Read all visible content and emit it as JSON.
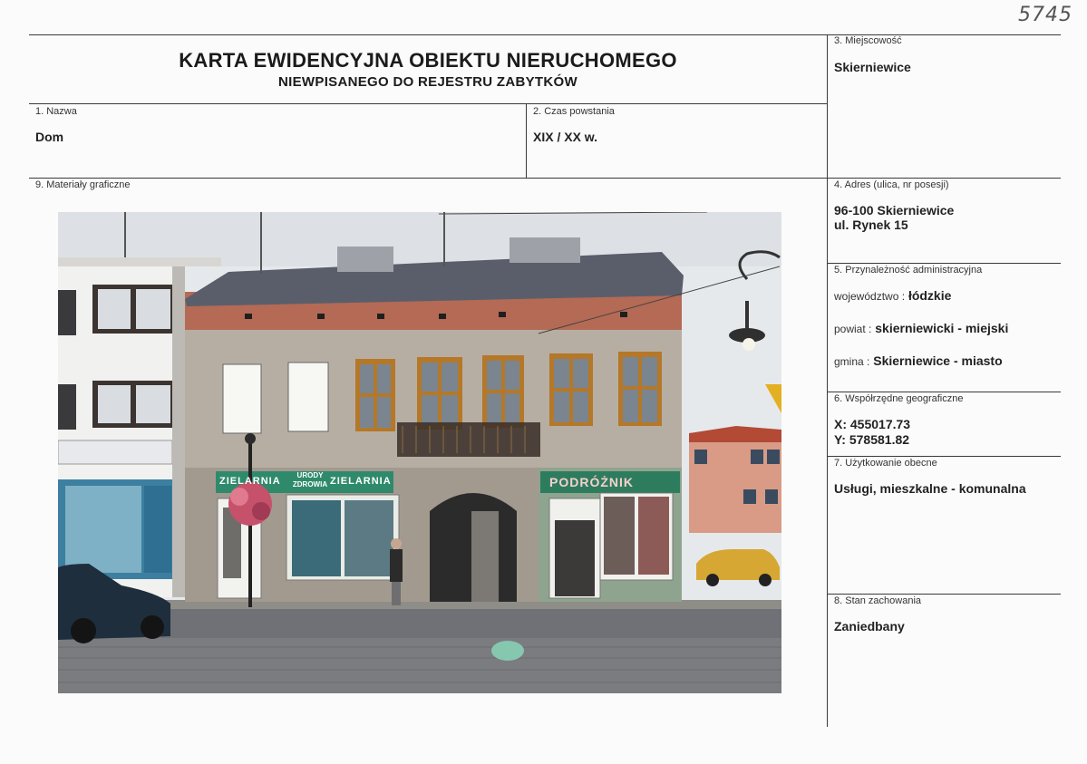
{
  "doc_number": "5745",
  "header": {
    "title": "KARTA EWIDENCYJNA OBIEKTU NIERUCHOMEGO",
    "subtitle": "NIEWPISANEGO DO REJESTRU ZABYTKÓW"
  },
  "fields": {
    "miejscowosc": {
      "label": "3. Miejscowość",
      "value": "Skierniewice"
    },
    "nazwa": {
      "label": "1. Nazwa",
      "value": "Dom"
    },
    "czas": {
      "label": "2. Czas powstania",
      "value": "XIX / XX w."
    },
    "materialy": {
      "label": "9. Materiały graficzne"
    },
    "adres": {
      "label": "4. Adres (ulica, nr posesji)",
      "line1": "96-100 Skierniewice",
      "line2": "ul. Rynek 15"
    },
    "przynaleznosc": {
      "label": "5. Przynależność administracyjna",
      "woj_label": "województwo :",
      "woj_value": "łódzkie",
      "powiat_label": "powiat :",
      "powiat_value": "skierniewicki - miejski",
      "gmina_label": "gmina :",
      "gmina_value": "Skierniewice - miasto"
    },
    "wspolrzedne": {
      "label": "6. Współrzędne geograficzne",
      "x": "X: 455017.73",
      "y": "Y: 578581.82"
    },
    "uzytkowanie": {
      "label": "7. Użytkowanie obecne",
      "value": "Usługi, mieszkalne - komunalna"
    },
    "stan": {
      "label": "8. Stan zachowania",
      "value": "Zaniedbany"
    }
  },
  "photo_signs": {
    "shop1": "ZIELARNIA",
    "shop1b": "URODY ZDROWIA",
    "shop1c": "ZIELARNIA",
    "shop2": "PODRÓŻNIK"
  }
}
